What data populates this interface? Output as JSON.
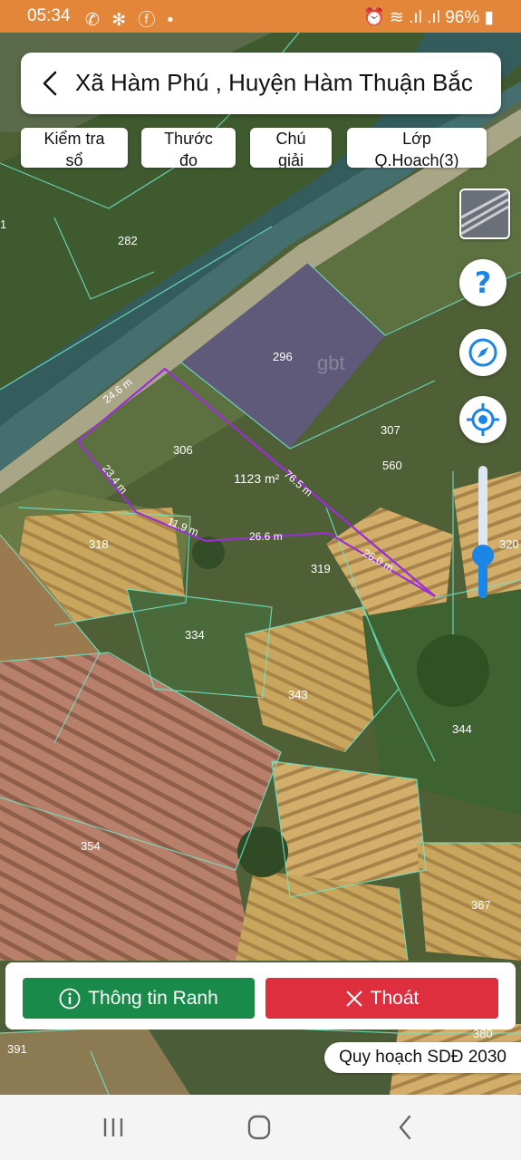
{
  "status_bar": {
    "time": "05:34",
    "battery": "96%",
    "left_icons": "✆ ✻ ⓕ •",
    "right_icons": "⏰ ≋ .ıl .ıl"
  },
  "header": {
    "title": "Xã Hàm Phú , Huyện Hàm Thuận Bắc"
  },
  "toolbar": [
    {
      "line1": "Kiểm tra",
      "line2": "sổ"
    },
    {
      "line1": "Thước",
      "line2": "đo"
    },
    {
      "line1": "Chú",
      "line2": "giải"
    },
    {
      "line1": "Lớp",
      "line2": "Q.Hoach(3)"
    }
  ],
  "map": {
    "watermark": "gbt",
    "parcel_numbers": [
      "282",
      "296",
      "306",
      "307",
      "560",
      "318",
      "319",
      "320",
      "334",
      "343",
      "344",
      "354",
      "367",
      "380",
      "391",
      "1"
    ],
    "area_label": "1123 m²",
    "measurements": [
      "24.6 m",
      "76.5 m",
      "23.4 m",
      "11.9 m",
      "26.6 m",
      "26.0 m"
    ]
  },
  "actions": {
    "info_label": "Thông tin Ranh",
    "exit_label": "Thoát"
  },
  "chip": {
    "label": "Quy hoạch SDĐ 2030"
  },
  "colors": {
    "status": "#e3863a",
    "info_button": "#1a8a4a",
    "exit_button": "#de2f3f",
    "measure_line": "#9b2fd6",
    "accent_blue": "#1c86e6"
  }
}
